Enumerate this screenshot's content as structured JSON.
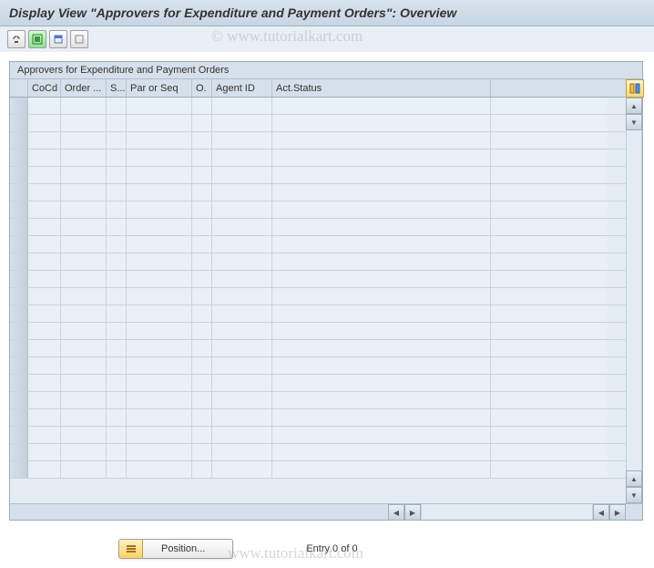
{
  "title": "Display View \"Approvers for Expenditure and Payment Orders\": Overview",
  "watermark": "© www.tutorialkart.com",
  "footer_watermark": "www.tutorialkart.com",
  "table": {
    "title": "Approvers for Expenditure and Payment Orders",
    "columns": {
      "cocd": "CoCd",
      "order": "Order ...",
      "s": "S...",
      "parseq": "Par or Seq",
      "o": "O.",
      "agent": "Agent ID",
      "act": "Act.Status"
    },
    "row_count": 22
  },
  "bottom": {
    "position_label": "Position...",
    "entry_text": "Entry 0 of 0"
  }
}
